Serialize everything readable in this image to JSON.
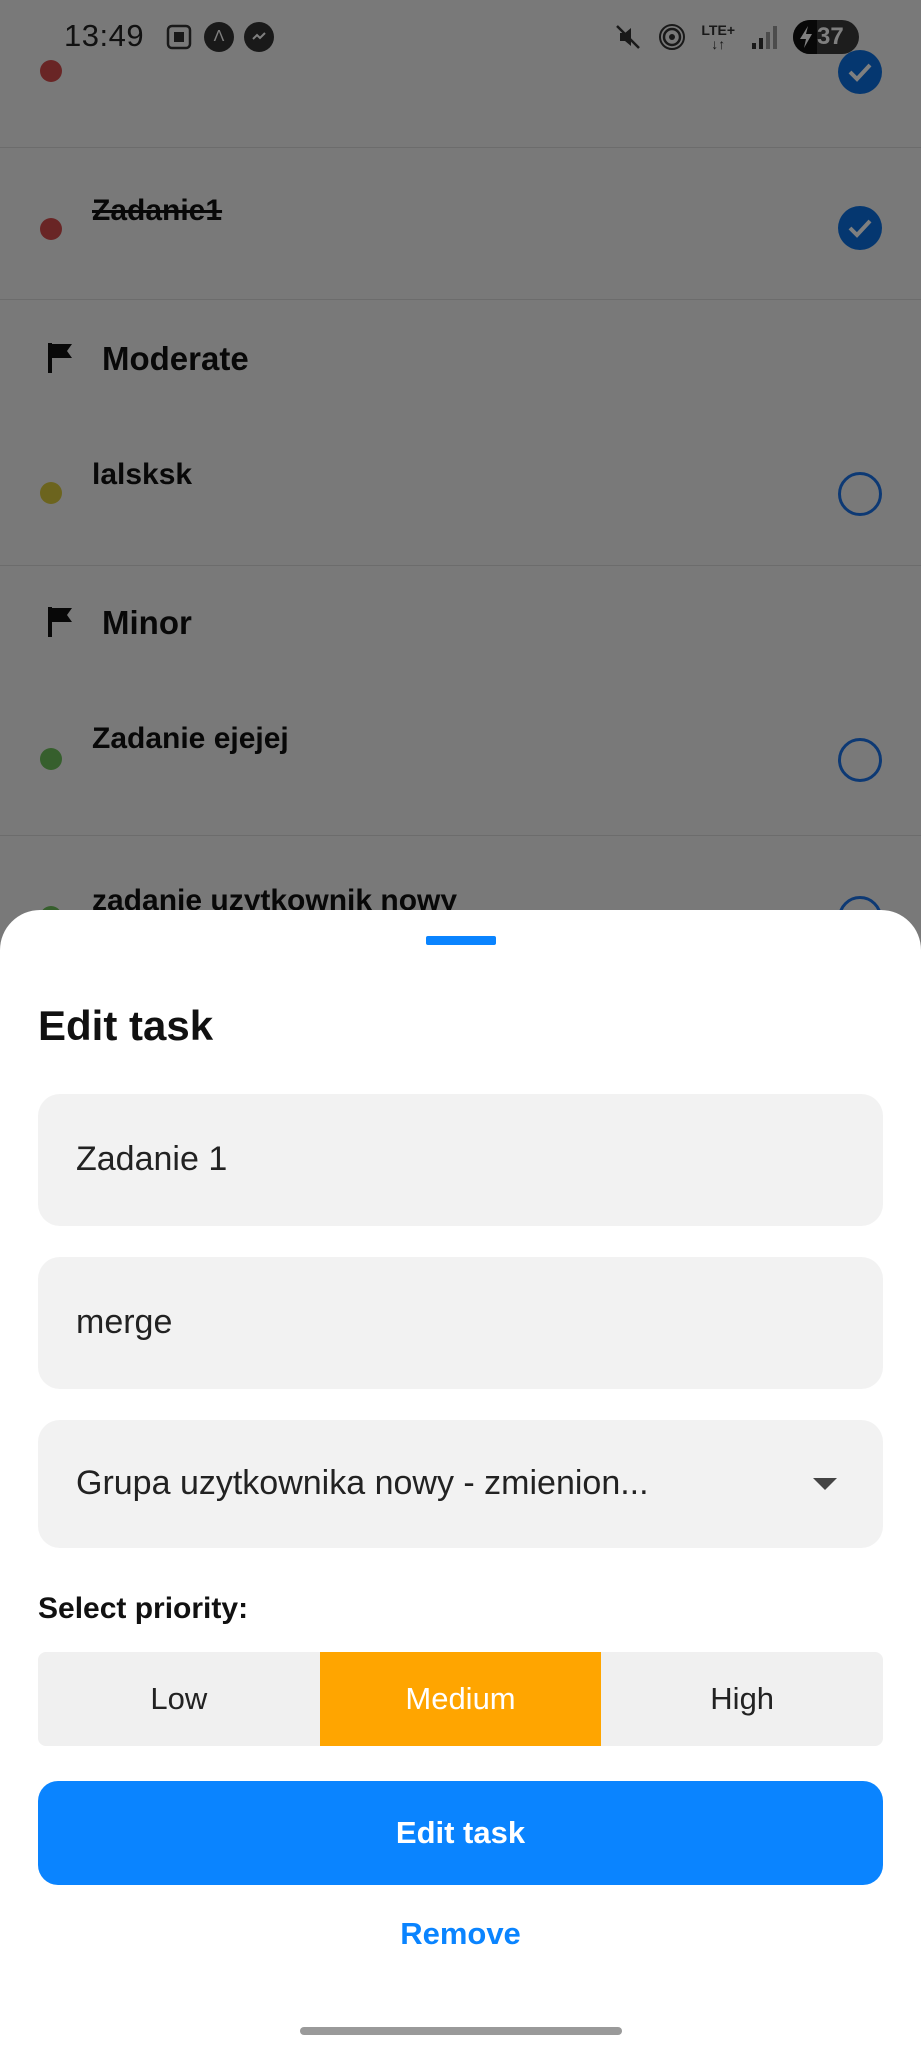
{
  "status_bar": {
    "time": "13:49",
    "network": "LTE+",
    "battery": "37",
    "battery_level": 0.37,
    "left_icons": [
      "screenshot-icon",
      "app-icon",
      "messenger-icon"
    ],
    "right_icons": [
      "mute-icon",
      "hotspot-icon",
      "lte-icon",
      "signal-icon",
      "battery-icon"
    ]
  },
  "task_list": {
    "rows": [
      {
        "name": "Zadanie1",
        "done": true,
        "color": "#d24b4b"
      },
      {
        "name": "lalsksk",
        "done": false,
        "color": "#d9c93c"
      },
      {
        "name": "Zadanie ejejej",
        "done": false,
        "color": "#6cbf5a"
      },
      {
        "name": "zadanie uzytkownik nowy",
        "done": false,
        "color": "#6cbf5a"
      }
    ],
    "sections": [
      {
        "label": "Moderate",
        "icon": "flag-icon"
      },
      {
        "label": "Minor",
        "icon": "flag-icon"
      }
    ],
    "top_row_color": "#d24b4b"
  },
  "sheet": {
    "title": "Edit task",
    "name_value": "Zadanie 1",
    "description_value": "merge",
    "group_value": "Grupa uzytkownika nowy - zmienion...",
    "priority_label": "Select priority:",
    "priorities": [
      "Low",
      "Medium",
      "High"
    ],
    "selected_priority": "Medium",
    "submit_label": "Edit task",
    "remove_label": "Remove"
  },
  "colors": {
    "accent": "#0a84ff",
    "priority_active": "#ffa500"
  }
}
